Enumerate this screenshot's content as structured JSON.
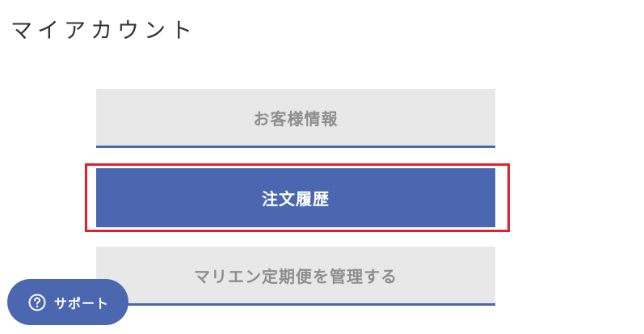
{
  "page": {
    "title": "マイアカウント"
  },
  "menu": {
    "customer_info": "お客様情報",
    "order_history": "注文履歴",
    "subscription": "マリエン定期便を管理する"
  },
  "support": {
    "label": "サポート",
    "icon": "question-circle-icon"
  },
  "colors": {
    "accent": "#4a67b0",
    "inactive_bg": "#e8e8e8",
    "inactive_text": "#8e8e8e",
    "highlight": "#e31f2a"
  }
}
